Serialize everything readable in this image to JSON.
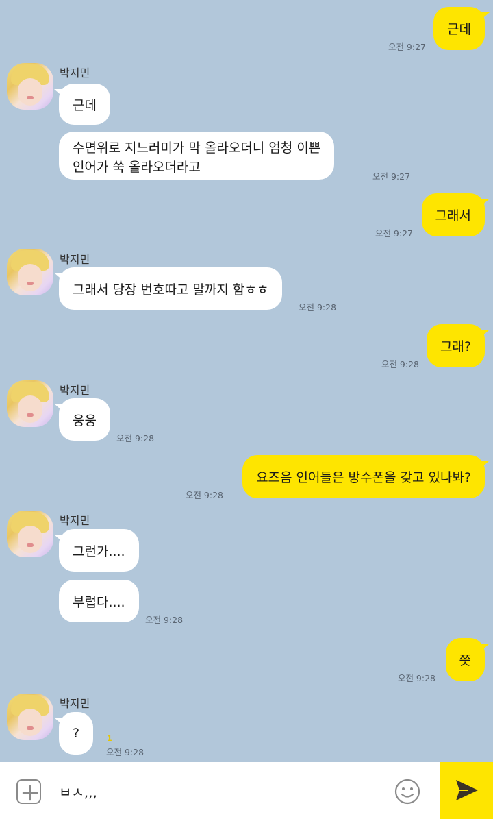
{
  "contact": {
    "name": "박지민"
  },
  "messages": [
    {
      "from": "me",
      "text": "근데",
      "time": "오전 9:27"
    },
    {
      "from": "them",
      "text": "근데"
    },
    {
      "from": "them",
      "lines": [
        "수면위로 지느러미가 막 올라오더니 엄청 이쁜",
        "인어가 쑥 올라오더라고"
      ],
      "time": "오전 9:27"
    },
    {
      "from": "me",
      "text": "그래서",
      "time": "오전 9:27"
    },
    {
      "from": "them",
      "text": "그래서 당장 번호따고 말까지 함ㅎㅎ",
      "time": "오전 9:28"
    },
    {
      "from": "me",
      "text": "그래?",
      "time": "오전 9:28"
    },
    {
      "from": "them",
      "text": "웅웅",
      "time": "오전 9:28"
    },
    {
      "from": "me",
      "text": "요즈음 인어들은 방수폰을 갖고 있나봐?",
      "time": "오전 9:28"
    },
    {
      "from": "them",
      "text": "그런가...."
    },
    {
      "from": "them",
      "text": "부럽다....",
      "time": "오전 9:28"
    },
    {
      "from": "me",
      "text": "쯧",
      "time": "오전 9:28"
    },
    {
      "from": "them",
      "text": "?",
      "time": "오전 9:28",
      "unread": "1"
    }
  ],
  "input": {
    "value": "ㅂㅅ,,,",
    "plus_icon": "plus-icon",
    "emoji_icon": "smiley-icon",
    "send_icon": "send-icon"
  },
  "colors": {
    "background": "#b2c7da",
    "my_bubble": "#fee500",
    "their_bubble": "#ffffff",
    "send_button": "#fee500"
  }
}
